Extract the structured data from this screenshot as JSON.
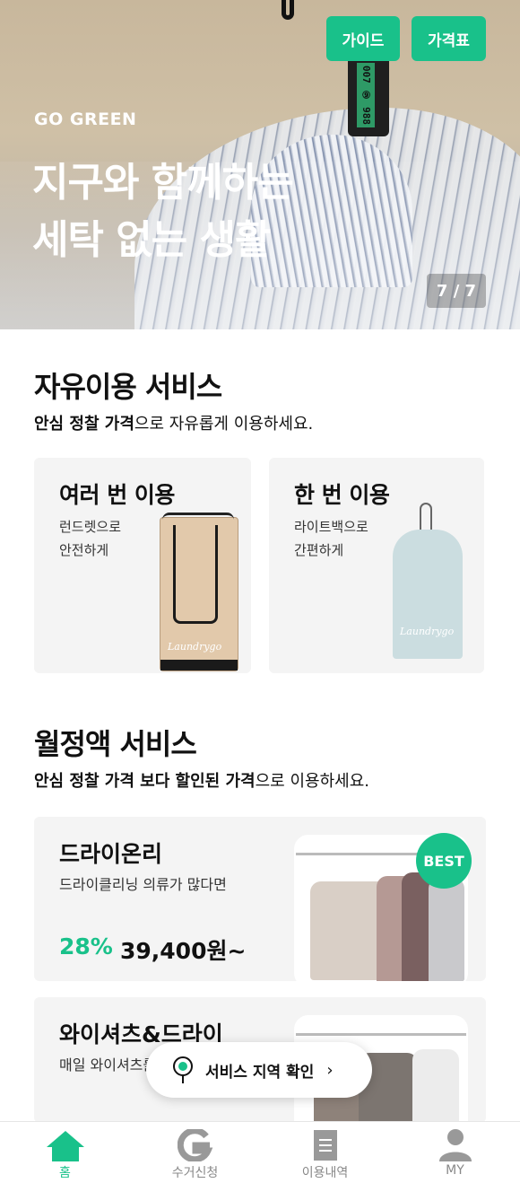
{
  "hero": {
    "guide_button": "가이드",
    "price_button": "가격표",
    "brand": "GO GREEN",
    "headline_line1": "지구와 함께하는",
    "headline_line2": "세탁 없는 생활",
    "pager": "7 / 7",
    "tag_text": "007 ⑨ 988"
  },
  "free_service": {
    "title": "자유이용 서비스",
    "subtitle_bold": "안심 정찰 가격",
    "subtitle_rest": "으로 자유롭게 이용하세요.",
    "cards": [
      {
        "title": "여러 번 이용",
        "desc_line1": "런드렛으로",
        "desc_line2": "안전하게",
        "logo": "Laundrygo"
      },
      {
        "title": "한 번 이용",
        "desc_line1": "라이트백으로",
        "desc_line2": "간편하게",
        "logo": "Laundrygo"
      }
    ]
  },
  "monthly_service": {
    "title": "월정액 서비스",
    "subtitle_bold": "안심 정찰 가격 보다 할인된 가격",
    "subtitle_rest": "으로 이용하세요.",
    "plans": [
      {
        "title": "드라이온리",
        "desc": "드라이클리닝 의류가 많다면",
        "discount": "28%",
        "price": "39,400원~",
        "badge": "BEST"
      },
      {
        "title": "와이셔츠&드라이",
        "desc": "매일 와이셔츠를 입는다면"
      }
    ]
  },
  "floating": {
    "label": "서비스 지역 확인",
    "chevron": "›"
  },
  "nav": {
    "items": [
      {
        "label": "홈",
        "icon": "home-icon",
        "active": true
      },
      {
        "label": "수거신청",
        "icon": "pickup-g-icon",
        "active": false
      },
      {
        "label": "이용내역",
        "icon": "document-icon",
        "active": false
      },
      {
        "label": "MY",
        "icon": "person-icon",
        "active": false
      }
    ]
  },
  "colors": {
    "accent": "#19c18a",
    "card_bg": "#f4f4f4"
  }
}
